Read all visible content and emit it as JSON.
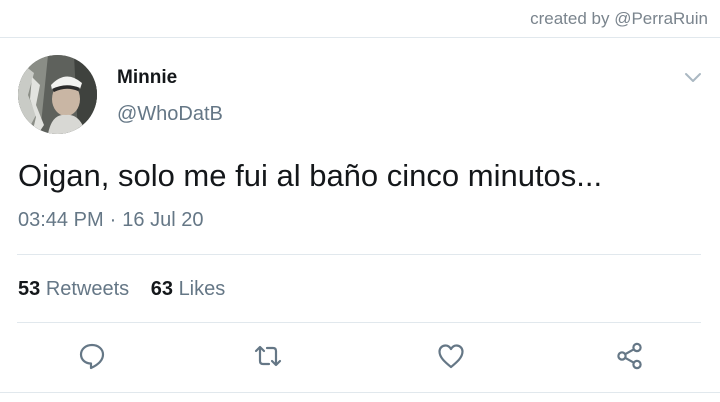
{
  "credit": "created by @PerraRuin",
  "tweet": {
    "author_name": "Minnie",
    "author_handle": "@WhoDatB",
    "text": "Oigan, solo me fui al baño cinco minutos...",
    "time": "03:44 PM",
    "date": "16 Jul 20"
  },
  "stats": {
    "retweets_count": "53",
    "retweets_label": "Retweets",
    "likes_count": "63",
    "likes_label": "Likes"
  },
  "icons": {
    "caret": "chevron-down-icon",
    "reply": "reply-icon",
    "retweet": "retweet-icon",
    "like": "heart-icon",
    "share": "share-icon"
  },
  "colors": {
    "text_primary": "#14171a",
    "text_secondary": "#657786",
    "divider": "#e1e8ed",
    "icon": "#657786"
  }
}
